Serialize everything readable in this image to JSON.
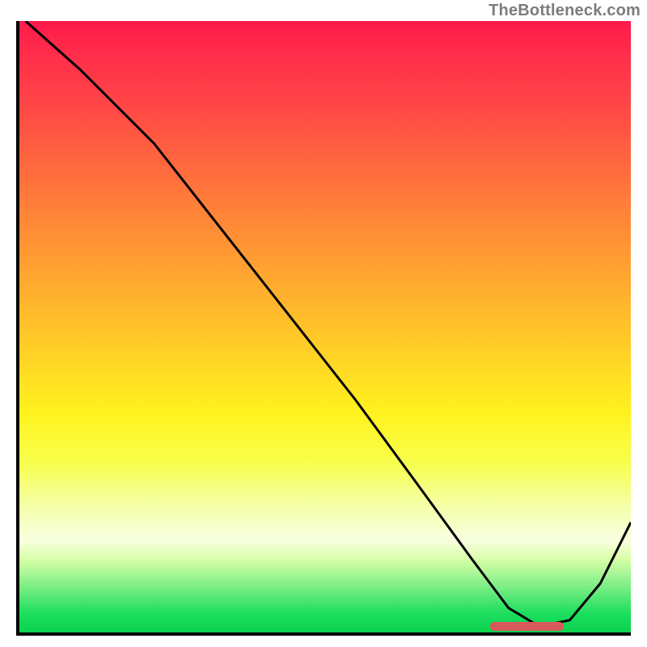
{
  "attribution": "TheBottleneck.com",
  "colors": {
    "gradient_top": "#ff1a4b",
    "gradient_bottom": "#0bd24f",
    "curve": "#000000",
    "marker": "#d65a5a",
    "axis": "#000000"
  },
  "chart_data": {
    "type": "line",
    "title": "",
    "xlabel": "",
    "ylabel": "",
    "xlim": [
      0,
      100
    ],
    "ylim": [
      0,
      100
    ],
    "grid": false,
    "legend": false,
    "background_gradient": {
      "direction": "top-to-bottom",
      "stops": [
        {
          "pos": 0,
          "color": "#ff1a4b"
        },
        {
          "pos": 50,
          "color": "#ffd026"
        },
        {
          "pos": 80,
          "color": "#f4ffb0"
        },
        {
          "pos": 100,
          "color": "#0bd24f"
        }
      ]
    },
    "series": [
      {
        "name": "curve",
        "x": [
          1,
          10,
          22,
          33,
          44,
          55,
          66,
          74,
          80,
          85,
          90,
          95,
          100
        ],
        "y": [
          100,
          92,
          80,
          66,
          52,
          38,
          23,
          12,
          4,
          1,
          2,
          8,
          18
        ]
      }
    ],
    "annotations": [
      {
        "name": "optimal-range-marker",
        "type": "horizontal-band",
        "x_start": 77,
        "x_end": 89,
        "y": 1,
        "color": "#d65a5a"
      }
    ]
  }
}
